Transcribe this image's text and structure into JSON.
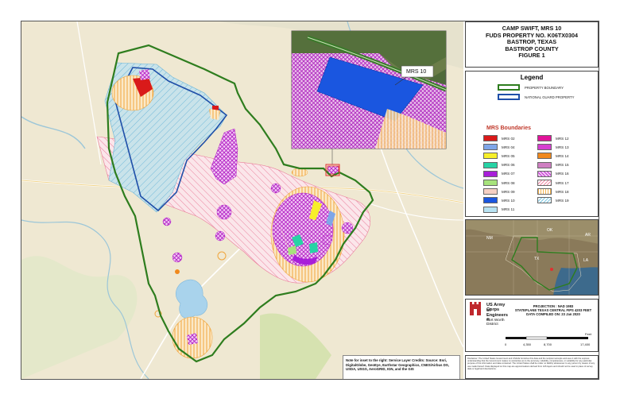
{
  "title_block": {
    "line1": "CAMP SWIFT, MRS 10",
    "line2": "FUDS PROPERTY NO. K06TX0304",
    "line3": "BASTROP, TEXAS",
    "line4": "BASTROP COUNTY",
    "line5": "FIGURE 1"
  },
  "legend": {
    "heading": "Legend",
    "property_boundary": "PROPERTY BOUNDARY",
    "national_guard": "NATIONAL GUARD PROPERTY",
    "mrs_heading": "MRS Boundaries",
    "items": [
      {
        "label": "MRS 02",
        "color": "#d91a1a",
        "pattern": "solid"
      },
      {
        "label": "MRS 04",
        "color": "#7fa6e8",
        "pattern": "solid"
      },
      {
        "label": "MRS 05",
        "color": "#f7ef2a",
        "pattern": "solid"
      },
      {
        "label": "MRS 06",
        "color": "#27d3a5",
        "pattern": "solid"
      },
      {
        "label": "MRS 07",
        "color": "#a81fd9",
        "pattern": "solid"
      },
      {
        "label": "MRS 08",
        "color": "#a7e37c",
        "pattern": "solid"
      },
      {
        "label": "MRS 09",
        "color": "#f6d0c3",
        "pattern": "solid"
      },
      {
        "label": "MRS 10",
        "color": "#1a56e0",
        "pattern": "solid"
      },
      {
        "label": "MRS 11",
        "color": "#b7e2f2",
        "pattern": "solid"
      },
      {
        "label": "MRS 12",
        "color": "#e0149a",
        "pattern": "solid"
      },
      {
        "label": "MRS 13",
        "color": "#d63fd1",
        "pattern": "solid"
      },
      {
        "label": "MRS 14",
        "color": "#f0891d",
        "pattern": "solid"
      },
      {
        "label": "MRS 15",
        "color": "#cf7fc2",
        "pattern": "solid"
      },
      {
        "label": "MRS 16",
        "color": "#c02fd0",
        "pattern": "cross"
      },
      {
        "label": "MRS 17",
        "color": "#f08aa6",
        "pattern": "diag"
      },
      {
        "label": "MRS 18",
        "color": "#f3b34e",
        "pattern": "vert"
      },
      {
        "label": "MRS 19",
        "color": "#7ec8e3",
        "pattern": "diag"
      }
    ]
  },
  "map": {
    "callout_label": "MRS 10",
    "credits": "Note for inset to the right: Service Layer Credits: Source: Esri, DigitalGlobe, GeoEye, Earthstar Geographics, CNES/Airbus DS, USDA, USGS, AeroGRID, IGN, and the GIS",
    "boundary_color": "#2e7d1e",
    "guard_color": "#1f4fa8"
  },
  "inset": {
    "labels": [
      "NM",
      "OK",
      "AR",
      "TX",
      "LA"
    ]
  },
  "info": {
    "org_line1": "US Army Corps",
    "org_line2": "of Engineers ®",
    "district": "Fort Worth District",
    "projection": "PROJECTION : NAD 1983",
    "stateplane": "STATEPLANE TEXAS CENTRAL FIPS 4203 FEET",
    "date": "DATA COMPILED ON: 23 Jan 2020",
    "scale": [
      "0",
      "4,350",
      "8,700",
      "17,400"
    ],
    "scale_unit": "Feet"
  },
  "disclaimer": "Disclaimer: The United States Government and USACE furnishes this data and the recipient accepts and uses it with the express understanding that the Government makes no warranties as to the accuracy, reliability, completeness, or suitability for any particular purpose of the information and data contained. The United States shall be under no liability whatsoever to any person by reason of any use made thereof. Data displayed on this map are approximations derived from GIS layers and should not be used in place of survey data or legal land descriptions."
}
